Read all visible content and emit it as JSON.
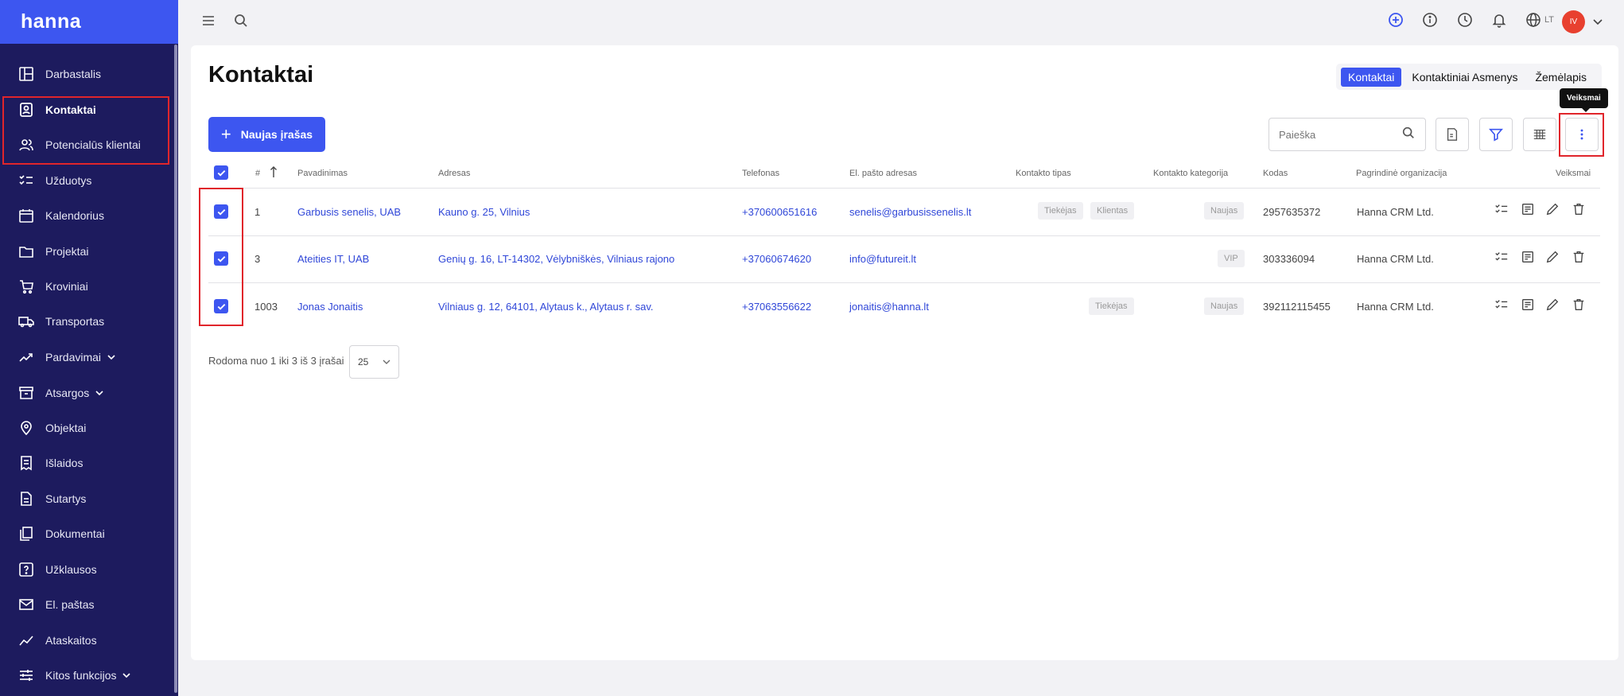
{
  "app": {
    "logo": "hanna"
  },
  "sidebar": {
    "items": [
      {
        "label": "Darbastalis",
        "icon": "dashboard-icon"
      },
      {
        "label": "Kontaktai",
        "icon": "contact-card-icon",
        "active": true
      },
      {
        "label": "Potencialūs klientai",
        "icon": "users-icon"
      },
      {
        "label": "Užduotys",
        "icon": "checklist-icon"
      },
      {
        "label": "Kalendorius",
        "icon": "calendar-icon"
      },
      {
        "label": "Projektai",
        "icon": "folder-icon"
      },
      {
        "label": "Kroviniai",
        "icon": "cart-icon"
      },
      {
        "label": "Transportas",
        "icon": "truck-icon"
      },
      {
        "label": "Pardavimai",
        "icon": "trend-icon",
        "expandable": true
      },
      {
        "label": "Atsargos",
        "icon": "archive-icon",
        "expandable": true
      },
      {
        "label": "Objektai",
        "icon": "location-pin-icon"
      },
      {
        "label": "Išlaidos",
        "icon": "expense-icon"
      },
      {
        "label": "Sutartys",
        "icon": "contract-icon"
      },
      {
        "label": "Dokumentai",
        "icon": "documents-icon"
      },
      {
        "label": "Užklausos",
        "icon": "question-icon"
      },
      {
        "label": "El. paštas",
        "icon": "mail-icon"
      },
      {
        "label": "Ataskaitos",
        "icon": "reports-icon"
      },
      {
        "label": "Kitos funkcijos",
        "icon": "sliders-icon",
        "expandable": true
      }
    ]
  },
  "topbar": {
    "language": "LT",
    "user_initials": "IV"
  },
  "page": {
    "title": "Kontaktai",
    "tabs": [
      "Kontaktai",
      "Kontaktiniai Asmenys",
      "Žemėlapis"
    ],
    "new_button": "Naujas įrašas",
    "search_placeholder": "Paieška",
    "tooltip": "Veiksmai"
  },
  "table": {
    "headers": {
      "num": "#",
      "name": "Pavadinimas",
      "address": "Adresas",
      "phone": "Telefonas",
      "email": "El. pašto adresas",
      "type": "Kontakto tipas",
      "category": "Kontakto kategorija",
      "code": "Kodas",
      "org": "Pagrindinė organizacija",
      "actions": "Veiksmai"
    },
    "rows": [
      {
        "num": "1",
        "name": "Garbusis senelis, UAB",
        "address": "Kauno g. 25, Vilnius",
        "phone": "+370600651616",
        "email": "senelis@garbusissenelis.lt",
        "types": [
          "Tiekėjas",
          "Klientas"
        ],
        "category": "Naujas",
        "code": "2957635372",
        "org": "Hanna CRM Ltd."
      },
      {
        "num": "3",
        "name": "Ateities IT, UAB",
        "address": "Genių g. 16, LT-14302, Vėlybniškės, Vilniaus rajono",
        "phone": "+37060674620",
        "email": "info@futureit.lt",
        "types": [],
        "category": "VIP",
        "code": "303336094",
        "org": "Hanna CRM Ltd."
      },
      {
        "num": "1003",
        "name": "Jonas Jonaitis",
        "address": "Vilniaus g. 12, 64101, Alytaus k., Alytaus r. sav.",
        "phone": "+37063556622",
        "email": "jonaitis@hanna.lt",
        "types": [
          "Tiekėjas"
        ],
        "category": "Naujas",
        "code": "392112115455",
        "org": "Hanna CRM Ltd."
      }
    ]
  },
  "pager": {
    "summary": "Rodoma nuo 1 iki 3 iš 3 įrašai",
    "page_size": "25"
  },
  "colors": {
    "accent": "#3d56f0",
    "sidebar": "#1d1b5e",
    "highlight": "#e0252b"
  }
}
